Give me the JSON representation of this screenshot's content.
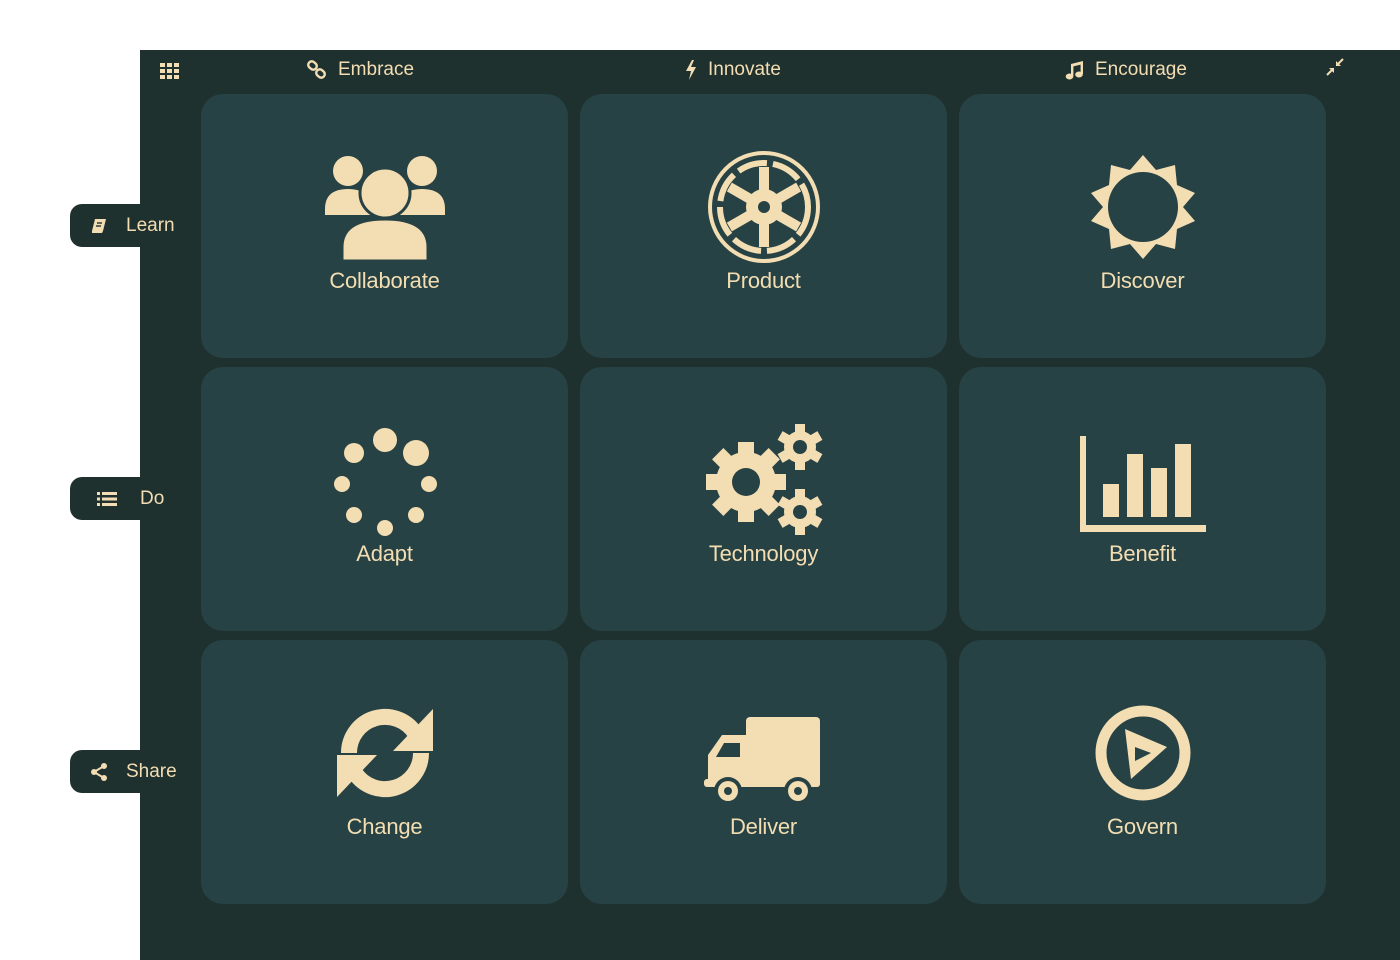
{
  "colors": {
    "panel": "#1f312f",
    "tile": "#274244",
    "accent": "#f3ddb2"
  },
  "topbar": {
    "grid_icon": "grid-icon",
    "items": [
      {
        "label": "Embrace",
        "icon": "link-icon"
      },
      {
        "label": "Innovate",
        "icon": "bolt-icon"
      },
      {
        "label": "Encourage",
        "icon": "music-icon"
      }
    ],
    "collapse_icon": "compress-icon"
  },
  "sidebar": {
    "tabs": [
      {
        "label": "Learn",
        "icon": "book-icon"
      },
      {
        "label": "Do",
        "icon": "list-icon"
      },
      {
        "label": "Share",
        "icon": "share-icon"
      }
    ]
  },
  "tiles": [
    {
      "label": "Collaborate",
      "icon": "group-icon"
    },
    {
      "label": "Product",
      "icon": "empire-icon"
    },
    {
      "label": "Discover",
      "icon": "sun-icon"
    },
    {
      "label": "Adapt",
      "icon": "spinner-icon"
    },
    {
      "label": "Technology",
      "icon": "gears-icon"
    },
    {
      "label": "Benefit",
      "icon": "bar-chart-icon"
    },
    {
      "label": "Change",
      "icon": "refresh-icon"
    },
    {
      "label": "Deliver",
      "icon": "truck-icon"
    },
    {
      "label": "Govern",
      "icon": "compass-icon"
    }
  ]
}
